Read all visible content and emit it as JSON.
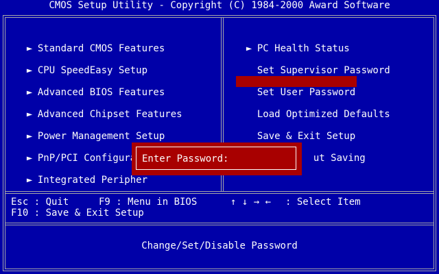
{
  "title": "CMOS Setup Utility - Copyright (C) 1984-2000 Award Software",
  "arrow_glyph": "►",
  "left_menu": [
    {
      "label": "Standard CMOS Features",
      "has_arrow": true
    },
    {
      "label": "CPU SpeedEasy Setup",
      "has_arrow": true
    },
    {
      "label": "Advanced BIOS Features",
      "has_arrow": true
    },
    {
      "label": "Advanced Chipset Features",
      "has_arrow": true
    },
    {
      "label": "Power Management Setup",
      "has_arrow": true
    },
    {
      "label": "PnP/PCI Configurati",
      "has_arrow": true
    },
    {
      "label": "Integrated Peripher",
      "has_arrow": true
    }
  ],
  "right_menu": [
    {
      "label": "PC Health Status",
      "has_arrow": true
    },
    {
      "label": "Set Supervisor Password",
      "has_arrow": false
    },
    {
      "label": "Set User Password",
      "has_arrow": false,
      "selected": true
    },
    {
      "label": "Load Optimized Defaults",
      "has_arrow": false
    },
    {
      "label": "Save & Exit Setup",
      "has_arrow": false
    },
    {
      "label": "ut Saving",
      "has_arrow": false
    }
  ],
  "help": {
    "esc": "Esc : Quit",
    "f9": "F9 : Menu in BIOS",
    "arrows": "↑ ↓ → ←",
    "select": ": Select Item",
    "f10": "F10 : Save & Exit Setup"
  },
  "status": "Change/Set/Disable Password",
  "dialog": {
    "label": "Enter Password:",
    "value": ""
  },
  "colors": {
    "background": "#0000a8",
    "highlight": "#a80000",
    "text": "#fcfcfc",
    "border": "#a8a8a8"
  }
}
